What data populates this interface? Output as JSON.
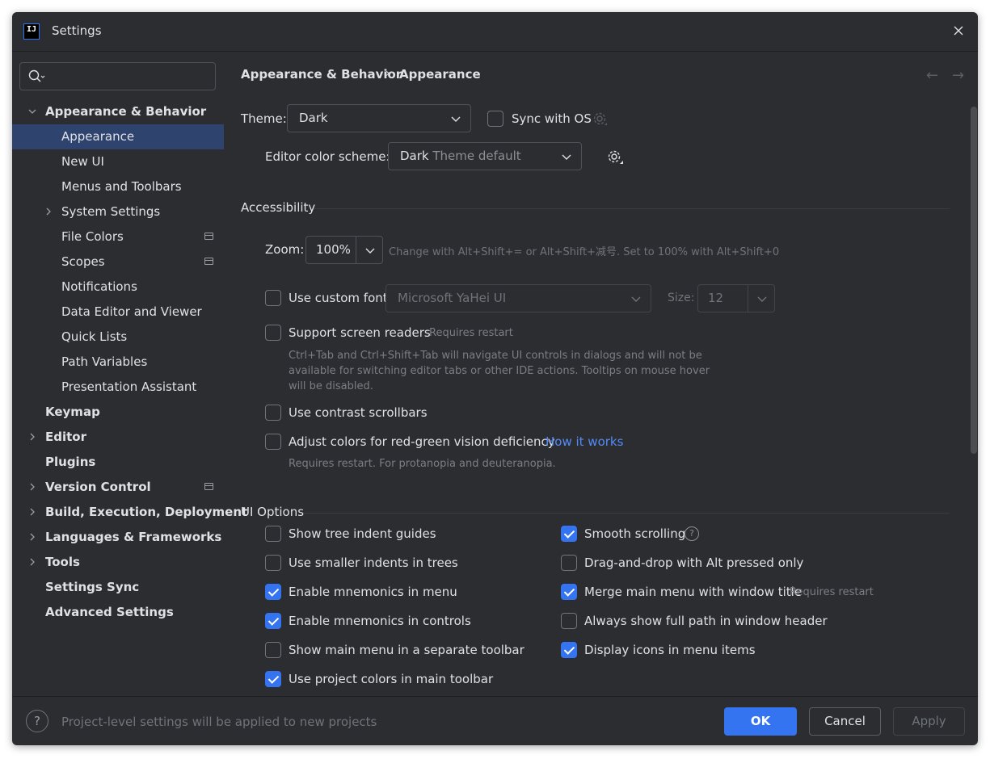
{
  "window": {
    "title": "Settings",
    "logo_text": "IJ"
  },
  "search": {
    "placeholder": "",
    "value": ""
  },
  "sidebar": {
    "items": [
      {
        "label": "Appearance & Behavior",
        "level": 0,
        "bold": true,
        "expandable": true,
        "expanded": true
      },
      {
        "label": "Appearance",
        "level": 1,
        "selected": true
      },
      {
        "label": "New UI",
        "level": 1
      },
      {
        "label": "Menus and Toolbars",
        "level": 1
      },
      {
        "label": "System Settings",
        "level": 1,
        "expandable": true
      },
      {
        "label": "File Colors",
        "level": 1,
        "project_icon": true
      },
      {
        "label": "Scopes",
        "level": 1,
        "project_icon": true
      },
      {
        "label": "Notifications",
        "level": 1
      },
      {
        "label": "Data Editor and Viewer",
        "level": 1
      },
      {
        "label": "Quick Lists",
        "level": 1
      },
      {
        "label": "Path Variables",
        "level": 1
      },
      {
        "label": "Presentation Assistant",
        "level": 1
      },
      {
        "label": "Keymap",
        "level": 0,
        "bold": true
      },
      {
        "label": "Editor",
        "level": 0,
        "bold": true,
        "expandable": true
      },
      {
        "label": "Plugins",
        "level": 0,
        "bold": true
      },
      {
        "label": "Version Control",
        "level": 0,
        "bold": true,
        "expandable": true,
        "project_icon": true
      },
      {
        "label": "Build, Execution, Deployment",
        "level": 0,
        "bold": true,
        "expandable": true
      },
      {
        "label": "Languages & Frameworks",
        "level": 0,
        "bold": true,
        "expandable": true
      },
      {
        "label": "Tools",
        "level": 0,
        "bold": true,
        "expandable": true
      },
      {
        "label": "Settings Sync",
        "level": 0,
        "bold": true
      },
      {
        "label": "Advanced Settings",
        "level": 0,
        "bold": true
      }
    ]
  },
  "breadcrumb": {
    "parent": "Appearance & Behavior",
    "separator": "›",
    "current": "Appearance"
  },
  "nav": {
    "back": "←",
    "forward": "→"
  },
  "theme": {
    "label": "Theme:",
    "value": "Dark",
    "sync_label": "Sync with OS",
    "sync_checked": false
  },
  "editor_scheme": {
    "label": "Editor color scheme:",
    "value_main": "Dark",
    "value_sub": "Theme default"
  },
  "accessibility": {
    "title": "Accessibility",
    "zoom_label": "Zoom:",
    "zoom_value": "100%",
    "zoom_hint": "Change with Alt+Shift+= or Alt+Shift+减号. Set to 100% with Alt+Shift+0",
    "custom_font_label": "Use custom font:",
    "custom_font_checked": false,
    "custom_font_value": "Microsoft YaHei UI",
    "size_label": "Size:",
    "size_value": "12",
    "screen_readers_label": "Support screen readers",
    "screen_readers_checked": false,
    "screen_readers_hint": "Requires restart",
    "screen_readers_desc": "Ctrl+Tab and Ctrl+Shift+Tab will navigate UI controls in dialogs and will not be available for switching editor tabs or other IDE actions. Tooltips on mouse hover will be disabled.",
    "contrast_scrollbars_label": "Use contrast scrollbars",
    "contrast_scrollbars_checked": false,
    "red_green_label": "Adjust colors for red-green vision deficiency",
    "red_green_checked": false,
    "red_green_link": "How it works",
    "red_green_desc": "Requires restart. For protanopia and deuteranopia."
  },
  "ui_options": {
    "title": "UI Options",
    "left": [
      {
        "label": "Show tree indent guides",
        "checked": false
      },
      {
        "label": "Use smaller indents in trees",
        "checked": false
      },
      {
        "label": "Enable mnemonics in menu",
        "checked": true
      },
      {
        "label": "Enable mnemonics in controls",
        "checked": true
      },
      {
        "label": "Show main menu in a separate toolbar",
        "checked": false
      },
      {
        "label": "Use project colors in main toolbar",
        "checked": true
      }
    ],
    "right": [
      {
        "label": "Smooth scrolling",
        "checked": true,
        "help": true
      },
      {
        "label": "Drag-and-drop with Alt pressed only",
        "checked": false
      },
      {
        "label": "Merge main menu with window title",
        "checked": true,
        "hint": "Requires restart"
      },
      {
        "label": "Always show full path in window header",
        "checked": false
      },
      {
        "label": "Display icons in menu items",
        "checked": true
      }
    ]
  },
  "footer": {
    "help": "?",
    "note": "Project-level settings will be applied to new projects",
    "ok": "OK",
    "cancel": "Cancel",
    "apply": "Apply"
  },
  "colors": {
    "accent": "#3574f0",
    "background": "#2b2d30",
    "selection": "#2e436e",
    "link": "#548af7"
  }
}
